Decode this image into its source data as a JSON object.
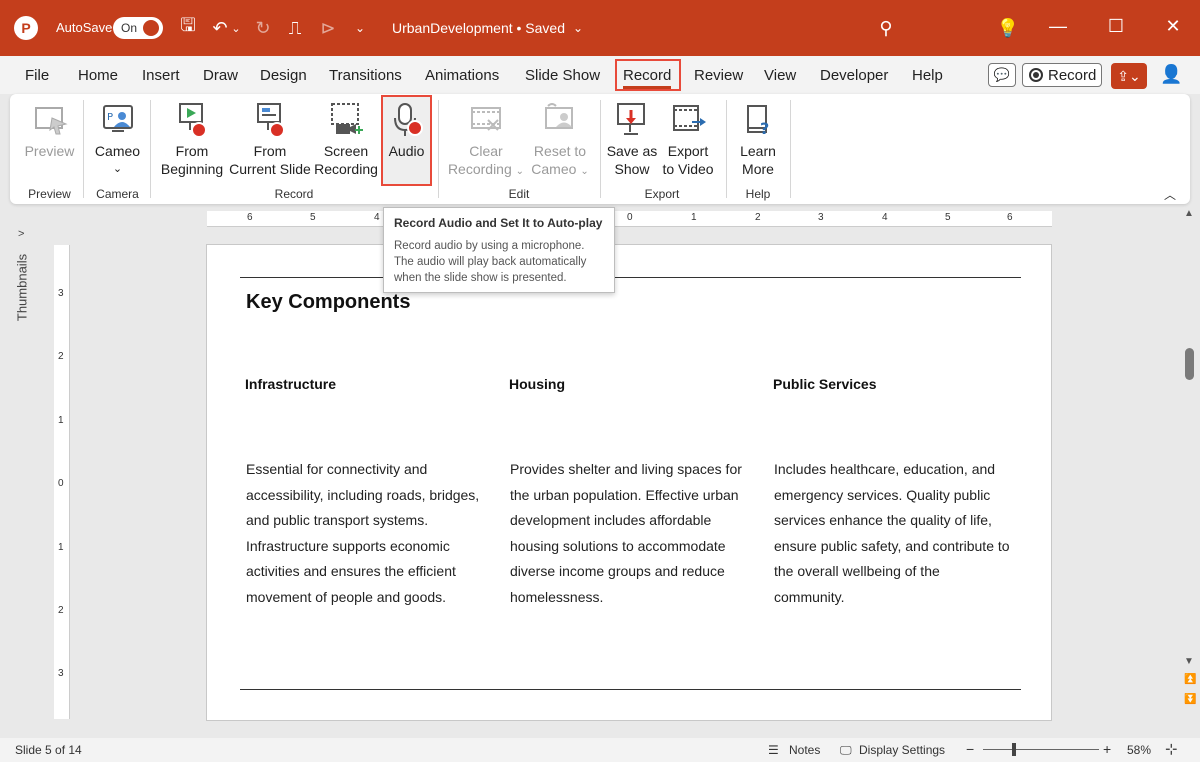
{
  "titlebar": {
    "app_logo": "P",
    "autosave_label": "AutoSave",
    "autosave_state": "On",
    "doc_title": "UrbanDevelopment • Saved",
    "accent_color": "#c43e1c"
  },
  "tabs": [
    "File",
    "Home",
    "Insert",
    "Draw",
    "Design",
    "Transitions",
    "Animations",
    "Slide Show",
    "Record",
    "Review",
    "View",
    "Developer",
    "Help"
  ],
  "active_tab": "Record",
  "header_buttons": {
    "record": "Record"
  },
  "ribbon": {
    "preview": {
      "label": "Preview",
      "group": "Preview"
    },
    "cameo": {
      "label": "Cameo",
      "group": "Camera"
    },
    "record_group": "Record",
    "from_beginning": [
      "From",
      "Beginning"
    ],
    "from_current": [
      "From",
      "Current Slide"
    ],
    "screen_recording": [
      "Screen",
      "Recording"
    ],
    "audio": "Audio",
    "edit_group": "Edit",
    "clear_recording": [
      "Clear",
      "Recording"
    ],
    "reset_to_cameo": [
      "Reset to",
      "Cameo"
    ],
    "export_group": "Export",
    "save_as_show": [
      "Save as",
      "Show"
    ],
    "export_to_video": [
      "Export",
      "to Video"
    ],
    "help_group": "Help",
    "learn_more": [
      "Learn",
      "More"
    ]
  },
  "tooltip": {
    "title": "Record Audio and Set It to Auto-play",
    "body": "Record audio by using a microphone. The audio will play back automatically when the slide show is presented."
  },
  "thumbnails_label": "Thumbnails",
  "slide": {
    "heading": "Key Components",
    "columns": [
      {
        "title": "Infrastructure",
        "body": "Essential for connectivity and accessibility, including roads, bridges, and public transport systems. Infrastructure supports economic activities and ensures the efficient movement of people and goods."
      },
      {
        "title": "Housing",
        "body": "Provides shelter and living spaces for the urban population. Effective urban development includes affordable housing solutions to accommodate diverse income groups and reduce homelessness."
      },
      {
        "title": "Public Services",
        "body": "Includes healthcare, education, and emergency services. Quality public services enhance the quality of life, ensure public safety, and contribute to the overall wellbeing of the community."
      }
    ]
  },
  "ruler": {
    "h_labels": [
      "6",
      "5",
      "4",
      "0",
      "1",
      "2",
      "3",
      "4",
      "5",
      "6"
    ],
    "v_labels": [
      "3",
      "2",
      "1",
      "0",
      "1",
      "2",
      "3"
    ]
  },
  "status": {
    "slide_info": "Slide 5 of 14",
    "notes": "Notes",
    "display_settings": "Display Settings",
    "zoom_minus": "−",
    "zoom_plus": "+",
    "zoom": "58%"
  }
}
